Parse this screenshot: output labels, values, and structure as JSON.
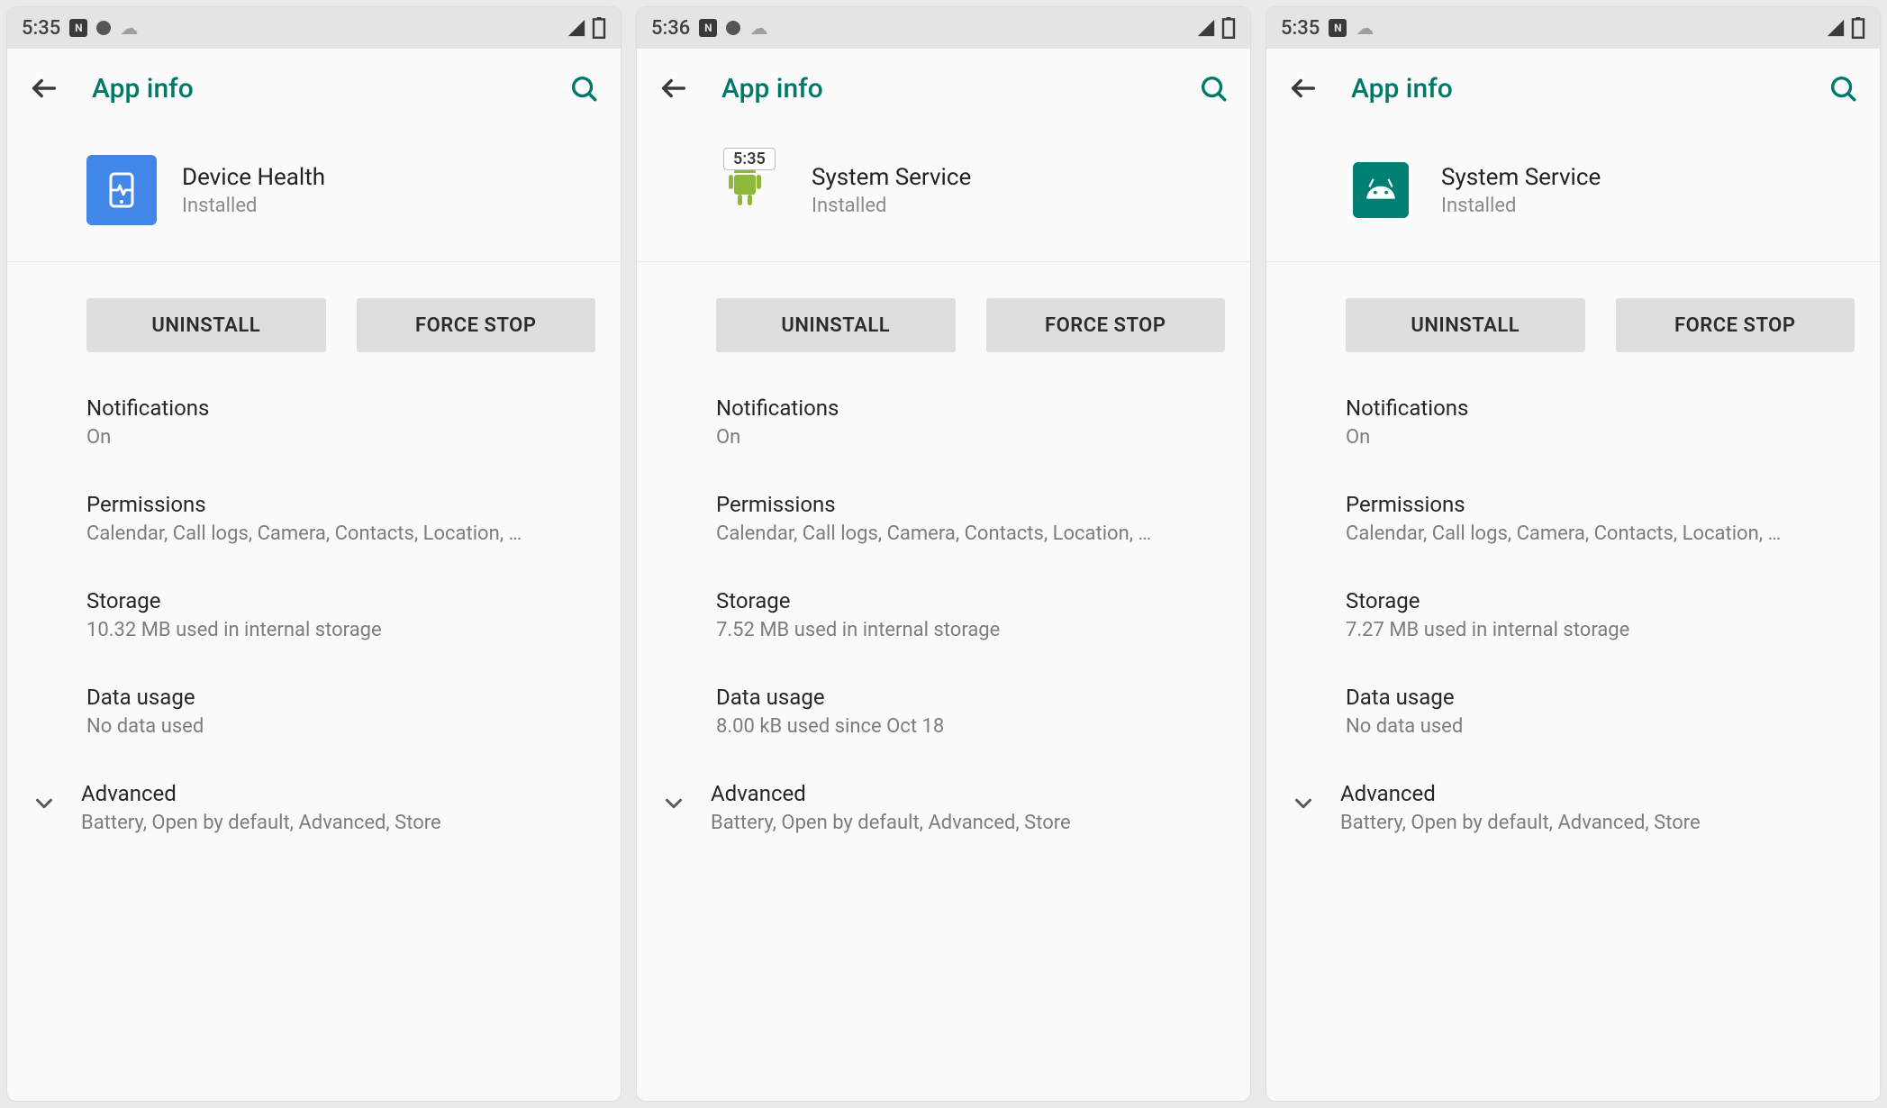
{
  "screens": [
    {
      "statusbar": {
        "time": "5:35",
        "has_extra_dot": true
      },
      "appbar": {
        "title": "App info"
      },
      "app": {
        "name": "Device Health",
        "status": "Installed",
        "icon": "device-health",
        "badge": ""
      },
      "buttons": {
        "uninstall": "UNINSTALL",
        "forcestop": "FORCE STOP"
      },
      "rows": {
        "notifications": {
          "title": "Notifications",
          "sub": "On"
        },
        "permissions": {
          "title": "Permissions",
          "sub": "Calendar, Call logs, Camera, Contacts, Location, …"
        },
        "storage": {
          "title": "Storage",
          "sub": "10.32 MB used in internal storage"
        },
        "datausage": {
          "title": "Data usage",
          "sub": "No data used"
        },
        "advanced": {
          "title": "Advanced",
          "sub": "Battery, Open by default, Advanced, Store"
        }
      }
    },
    {
      "statusbar": {
        "time": "5:36",
        "has_extra_dot": true
      },
      "appbar": {
        "title": "App info"
      },
      "app": {
        "name": "System Service",
        "status": "Installed",
        "icon": "android-bot",
        "badge": "5:35"
      },
      "buttons": {
        "uninstall": "UNINSTALL",
        "forcestop": "FORCE STOP"
      },
      "rows": {
        "notifications": {
          "title": "Notifications",
          "sub": "On"
        },
        "permissions": {
          "title": "Permissions",
          "sub": "Calendar, Call logs, Camera, Contacts, Location, …"
        },
        "storage": {
          "title": "Storage",
          "sub": "7.52 MB used in internal storage"
        },
        "datausage": {
          "title": "Data usage",
          "sub": "8.00 kB used since Oct 18"
        },
        "advanced": {
          "title": "Advanced",
          "sub": "Battery, Open by default, Advanced, Store"
        }
      }
    },
    {
      "statusbar": {
        "time": "5:35",
        "has_extra_dot": false
      },
      "appbar": {
        "title": "App info"
      },
      "app": {
        "name": "System Service",
        "status": "Installed",
        "icon": "android-teal",
        "badge": ""
      },
      "buttons": {
        "uninstall": "UNINSTALL",
        "forcestop": "FORCE STOP"
      },
      "rows": {
        "notifications": {
          "title": "Notifications",
          "sub": "On"
        },
        "permissions": {
          "title": "Permissions",
          "sub": "Calendar, Call logs, Camera, Contacts, Location, …"
        },
        "storage": {
          "title": "Storage",
          "sub": "7.27 MB used in internal storage"
        },
        "datausage": {
          "title": "Data usage",
          "sub": "No data used"
        },
        "advanced": {
          "title": "Advanced",
          "sub": "Battery, Open by default, Advanced, Store"
        }
      }
    }
  ]
}
